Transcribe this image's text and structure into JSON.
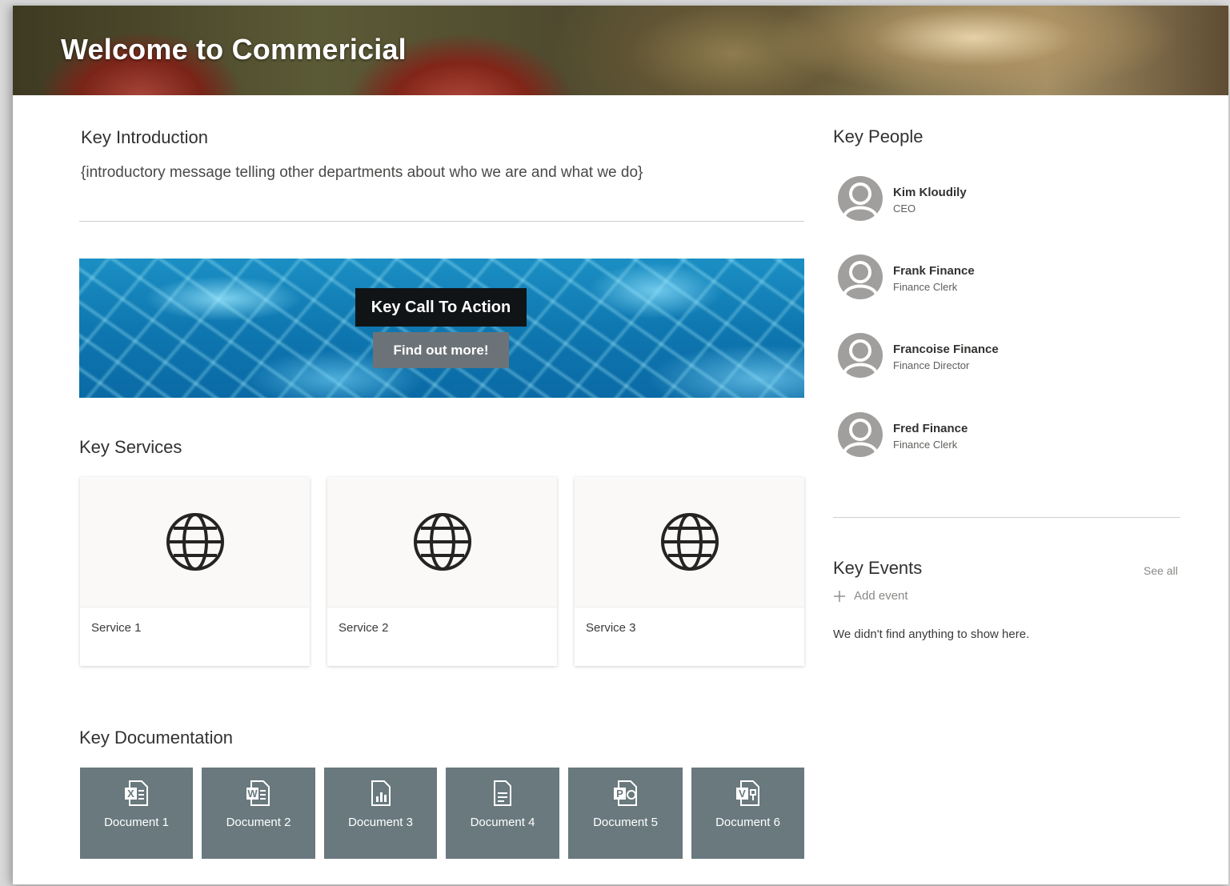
{
  "hero": {
    "title": "Welcome to Commericial"
  },
  "intro": {
    "heading": "Key Introduction",
    "text": "{introductory message telling other departments about who we are and what we do}"
  },
  "cta": {
    "heading": "Key Call To Action",
    "button_label": "Find out more!"
  },
  "services": {
    "heading": "Key Services",
    "items": [
      {
        "label": "Service 1",
        "icon": "globe-icon"
      },
      {
        "label": "Service 2",
        "icon": "globe-icon"
      },
      {
        "label": "Service 3",
        "icon": "globe-icon"
      }
    ]
  },
  "documentation": {
    "heading": "Key Documentation",
    "items": [
      {
        "label": "Document 1",
        "icon": "excel-file-icon",
        "letter": "X"
      },
      {
        "label": "Document 2",
        "icon": "word-file-icon",
        "letter": "W"
      },
      {
        "label": "Document 3",
        "icon": "chart-file-icon",
        "letter": ""
      },
      {
        "label": "Document 4",
        "icon": "text-file-icon",
        "letter": ""
      },
      {
        "label": "Document 5",
        "icon": "powerpoint-file-icon",
        "letter": "P"
      },
      {
        "label": "Document 6",
        "icon": "visio-file-icon",
        "letter": "V"
      }
    ]
  },
  "people": {
    "heading": "Key People",
    "items": [
      {
        "name": "Kim Kloudily",
        "title": "CEO"
      },
      {
        "name": "Frank Finance",
        "title": "Finance Clerk"
      },
      {
        "name": "Francoise Finance",
        "title": "Finance Director"
      },
      {
        "name": "Fred Finance",
        "title": "Finance Clerk"
      }
    ]
  },
  "events": {
    "heading": "Key Events",
    "see_all": "See all",
    "add_event": "Add event",
    "empty_message": "We didn't find anything to show here."
  },
  "colors": {
    "doc_tile": "#69797e",
    "cta_heading_bg": "#101416",
    "cta_button_bg": "#6b7378",
    "text_primary": "#323130",
    "text_muted": "#8a8886"
  }
}
